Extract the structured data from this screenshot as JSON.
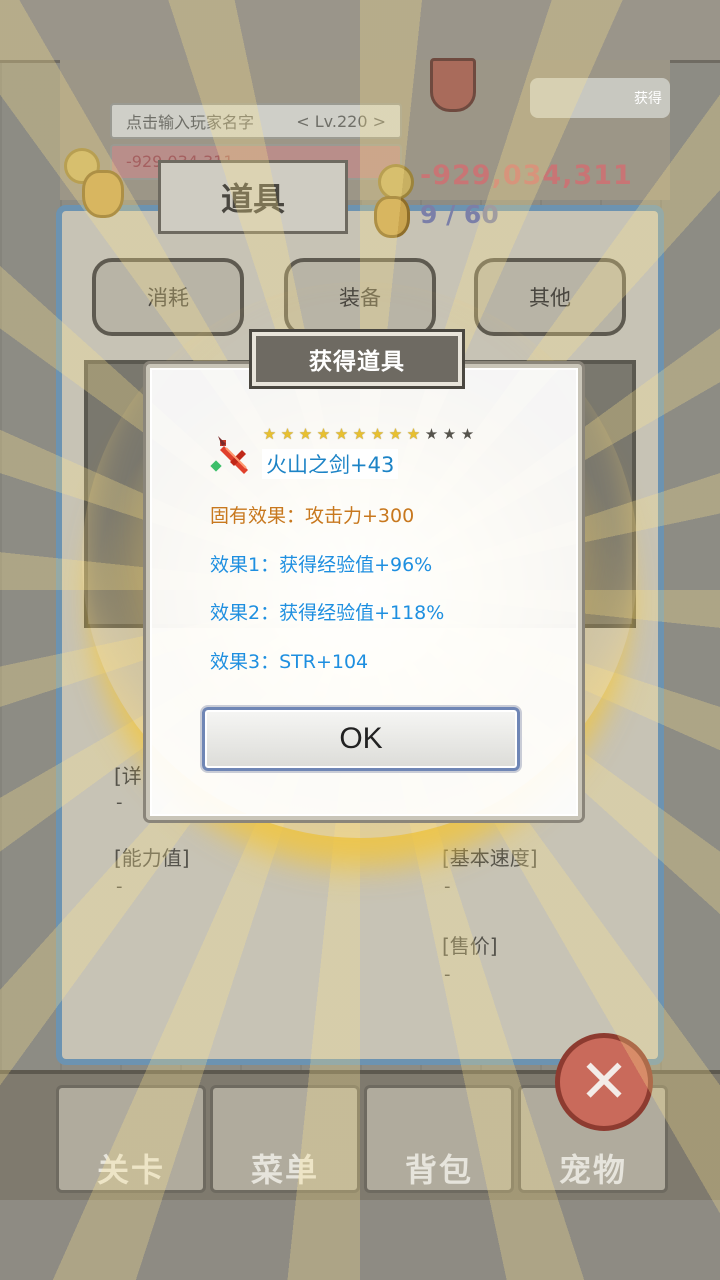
{
  "header": {
    "player_name_placeholder": "点击输入玩家名字",
    "level": "< Lv.220 >",
    "gold_small": "-929,034,311",
    "gold": "-929,034,311",
    "bag_count": "9 / 60",
    "vip_label": "获得"
  },
  "panel": {
    "title": "道具",
    "categories": [
      "消耗",
      "装备",
      "其他"
    ]
  },
  "detail": {
    "partial_label": "[详",
    "dash": "-",
    "ability_label": "[能力值]",
    "speed_label": "[基本速度]",
    "price_label": "[售价]"
  },
  "nav": {
    "items": [
      "关卡",
      "菜单",
      "背包",
      "宠物"
    ]
  },
  "dialog": {
    "title": "获得道具",
    "stars_total": 12,
    "stars_filled": 9,
    "item_name": "火山之剑+43",
    "fixed_effect": "固有效果：攻击力+300",
    "effects": [
      "效果1：获得经验值+96%",
      "效果2：获得经验值+118%",
      "效果3：STR+104"
    ],
    "ok_label": "OK"
  },
  "colors": {
    "fixed_effect": "#c8781e",
    "effect": "#1e8fe0",
    "item_name": "#1c83c6",
    "star_on": "#e8c030",
    "star_off": "#55534c"
  }
}
